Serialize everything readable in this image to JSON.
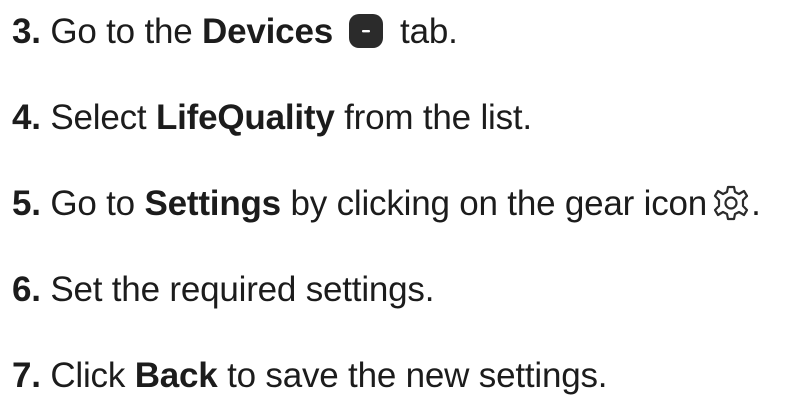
{
  "steps": [
    {
      "number": "3.",
      "text_a": "Go to the",
      "bold": "Devices",
      "text_b": "tab.",
      "icon": "devices-tab-icon"
    },
    {
      "number": "4.",
      "text_a": "Select",
      "bold": "LifeQuality",
      "text_b": "from the list."
    },
    {
      "number": "5.",
      "text_a": "Go to",
      "bold": "Settings",
      "text_b": "by clicking on the gear icon",
      "text_c": ".",
      "icon": "gear-icon"
    },
    {
      "number": "6.",
      "text_a": "Set the required settings."
    },
    {
      "number": "7.",
      "text_a": "Click",
      "bold": "Back",
      "text_b": "to save the new settings."
    }
  ],
  "colors": {
    "text": "#1c1c1c",
    "icon_fill": "#2b2b2b"
  }
}
